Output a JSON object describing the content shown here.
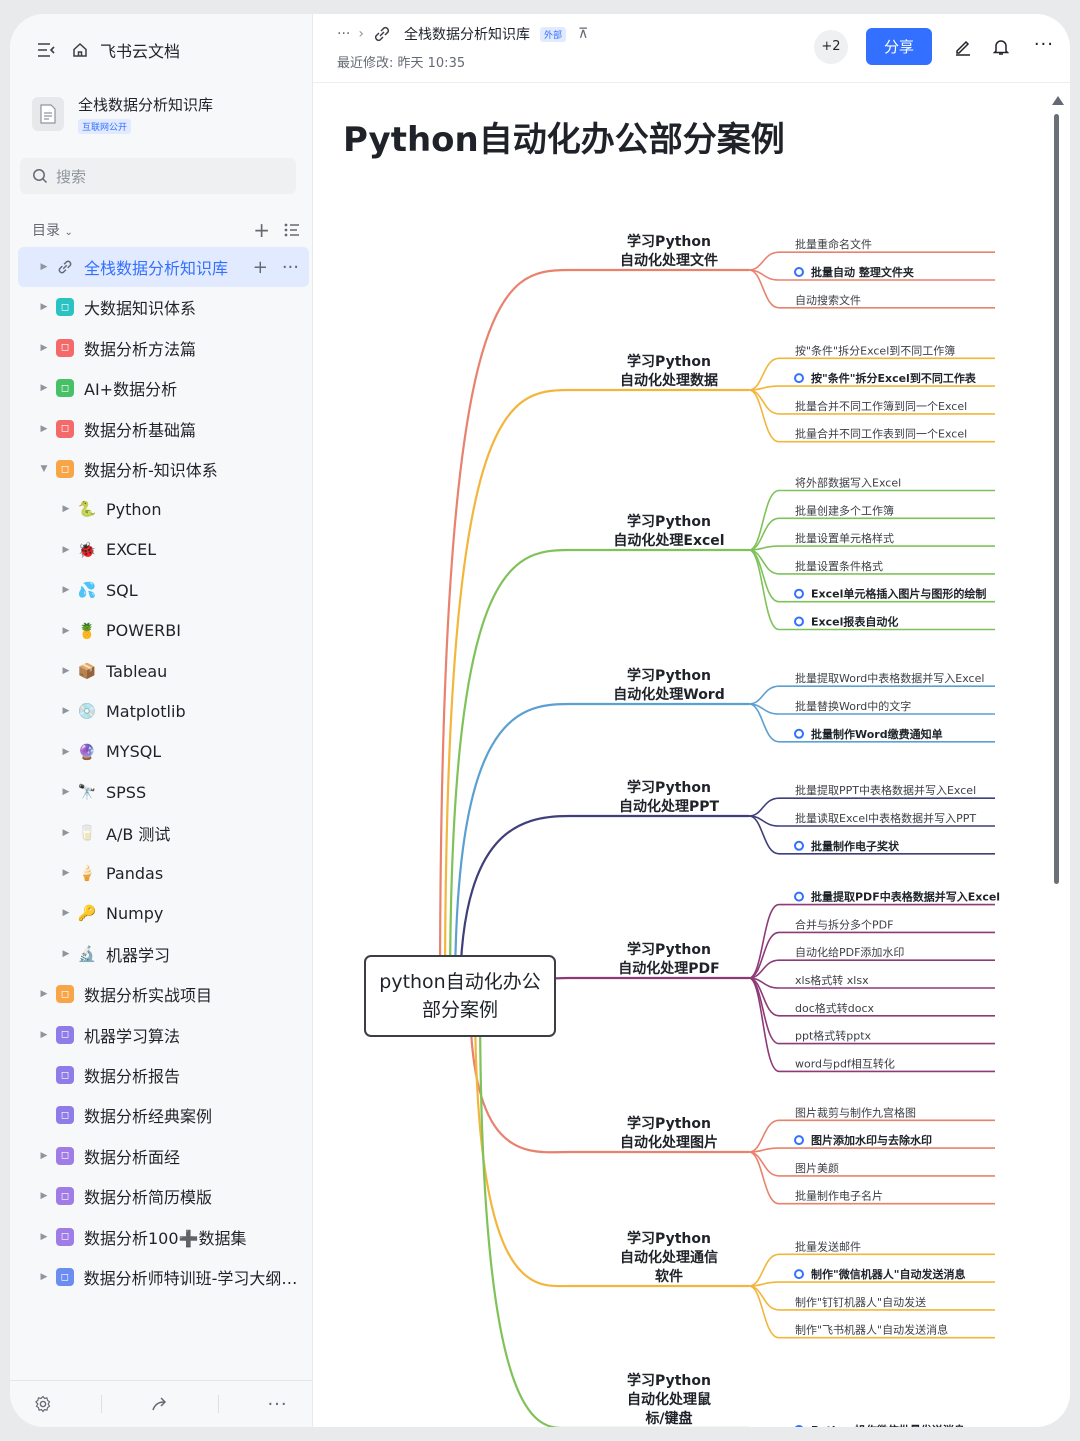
{
  "sidebar": {
    "brand": "飞书云文档",
    "space_title": "全栈数据分析知识库",
    "space_tag": "互联网公开",
    "search_placeholder": "搜索",
    "toc_label": "目录",
    "items": [
      {
        "label": "全栈数据分析知识库",
        "level": 0,
        "active": true,
        "icon": "link-icon"
      },
      {
        "label": "大数据知识体系",
        "level": 0,
        "icon": "teal-square-icon",
        "color": "#2bc2c2"
      },
      {
        "label": "数据分析方法篇",
        "level": 0,
        "icon": "red-square-icon",
        "color": "#f46a6a"
      },
      {
        "label": "AI+数据分析",
        "level": 0,
        "icon": "green-square-icon",
        "color": "#47c068"
      },
      {
        "label": "数据分析基础篇",
        "level": 0,
        "icon": "red-square-icon",
        "color": "#f46a6a"
      },
      {
        "label": "数据分析-知识体系",
        "level": 0,
        "expanded": true,
        "icon": "orange-square-icon",
        "color": "#f8a548"
      },
      {
        "label": "Python",
        "level": 1,
        "glyph": "🐍"
      },
      {
        "label": "EXCEL",
        "level": 1,
        "glyph": "🐞"
      },
      {
        "label": "SQL",
        "level": 1,
        "glyph": "💦"
      },
      {
        "label": "POWERBI",
        "level": 1,
        "glyph": "🍍"
      },
      {
        "label": "Tableau",
        "level": 1,
        "glyph": "📦"
      },
      {
        "label": "Matplotlib",
        "level": 1,
        "glyph": "💿"
      },
      {
        "label": "MYSQL",
        "level": 1,
        "glyph": "🔮"
      },
      {
        "label": "SPSS",
        "level": 1,
        "glyph": "🔭"
      },
      {
        "label": "A/B 测试",
        "level": 1,
        "glyph": "🥛"
      },
      {
        "label": "Pandas",
        "level": 1,
        "glyph": "🍦"
      },
      {
        "label": "Numpy",
        "level": 1,
        "glyph": "🔑"
      },
      {
        "label": "机器学习",
        "level": 1,
        "glyph": "🔬"
      },
      {
        "label": "数据分析实战项目",
        "level": 0,
        "icon": "orange-square-icon",
        "color": "#f8a548"
      },
      {
        "label": "机器学习算法",
        "level": 0,
        "icon": "purple-square-icon",
        "color": "#8f7ce8"
      },
      {
        "label": "数据分析报告",
        "level": 0,
        "noarrow": true,
        "icon": "purple-square-icon",
        "color": "#8f7ce8"
      },
      {
        "label": "数据分析经典案例",
        "level": 0,
        "noarrow": true,
        "icon": "purple-square-icon",
        "color": "#8f7ce8"
      },
      {
        "label": "数据分析面经",
        "level": 0,
        "icon": "violet-square-icon",
        "color": "#a07de6"
      },
      {
        "label": "数据分析简历模版",
        "level": 0,
        "icon": "violet-square-icon",
        "color": "#a07de6"
      },
      {
        "label": "数据分析100➕数据集",
        "level": 0,
        "icon": "violet-square-icon",
        "color": "#a07de6"
      },
      {
        "label": "数据分析师特训班-学习大纲（...",
        "level": 0,
        "icon": "blue-square-icon",
        "color": "#6b8cf0"
      }
    ]
  },
  "header": {
    "breadcrumb_more": "···",
    "doc_title": "全栈数据分析知识库",
    "external_tag": "外部",
    "last_modified": "最近修改: 昨天 10:35",
    "collaborators": "+2",
    "share_label": "分享"
  },
  "page": {
    "title": "Python自动化办公部分案例"
  },
  "mindmap": {
    "root": "python自动化办公\n部分案例",
    "branches": [
      {
        "title": "学习Python\n自动化处理文件",
        "color": "#e8826e",
        "items": [
          {
            "text": "批量重命名文件"
          },
          {
            "text": "批量自动 整理文件夹",
            "bold": true
          },
          {
            "text": "自动搜索文件"
          }
        ]
      },
      {
        "title": "学习Python\n自动化处理数据",
        "color": "#f2b63c",
        "items": [
          {
            "text": "按\"条件\"拆分Excel到不同工作簿"
          },
          {
            "text": "按\"条件\"拆分Excel到不同工作表",
            "bold": true
          },
          {
            "text": "批量合并不同工作簿到同一个Excel"
          },
          {
            "text": "批量合并不同工作表到同一个Excel"
          }
        ]
      },
      {
        "title": "学习Python\n自动化处理Excel",
        "color": "#7fc25a",
        "items": [
          {
            "text": "将外部数据写入Excel"
          },
          {
            "text": "批量创建多个工作簿"
          },
          {
            "text": "批量设置单元格样式"
          },
          {
            "text": "批量设置条件格式"
          },
          {
            "text": "Excel单元格插入图片与图形的绘制",
            "bold": true
          },
          {
            "text": "Excel报表自动化",
            "bold": true
          }
        ]
      },
      {
        "title": "学习Python\n自动化处理Word",
        "color": "#5c9fd1",
        "items": [
          {
            "text": "批量提取Word中表格数据并写入Excel"
          },
          {
            "text": "批量替换Word中的文字"
          },
          {
            "text": "批量制作Word缴费通知单",
            "bold": true
          }
        ]
      },
      {
        "title": "学习Python\n自动化处理PPT",
        "color": "#3f3f7a",
        "items": [
          {
            "text": "批量提取PPT中表格数据并写入Excel"
          },
          {
            "text": "批量读取Excel中表格数据并写入PPT"
          },
          {
            "text": "批量制作电子奖状",
            "bold": true
          }
        ]
      },
      {
        "title": "学习Python\n自动化处理PDF",
        "color": "#8e3a78",
        "items": [
          {
            "text": "批量提取PDF中表格数据并写入Excel",
            "bold": true
          },
          {
            "text": "合并与拆分多个PDF"
          },
          {
            "text": "自动化给PDF添加水印"
          },
          {
            "text": "xls格式转 xlsx"
          },
          {
            "text": "doc格式转docx"
          },
          {
            "text": "ppt格式转pptx"
          },
          {
            "text": "word与pdf相互转化"
          }
        ]
      },
      {
        "title": "学习Python\n自动化处理图片",
        "color": "#e8826e",
        "items": [
          {
            "text": "图片裁剪与制作九宫格图"
          },
          {
            "text": "图片添加水印与去除水印",
            "bold": true
          },
          {
            "text": "图片美颜"
          },
          {
            "text": "批量制作电子名片"
          }
        ]
      },
      {
        "title": "学习Python\n自动化处理通信\n软件",
        "color": "#f2b63c",
        "items": [
          {
            "text": "批量发送邮件"
          },
          {
            "text": "制作\"微信机器人\"自动发送消息",
            "bold": true
          },
          {
            "text": "制作\"钉钉机器人\"自动发送"
          },
          {
            "text": "制作\"飞书机器人\"自动发送消息"
          }
        ]
      },
      {
        "title": "学习Python\n自动化处理鼠\n标/键盘",
        "color": "#7fc25a",
        "items": [
          {
            "text": "Python操作微信批量发送消息",
            "bold": true
          }
        ]
      }
    ]
  }
}
